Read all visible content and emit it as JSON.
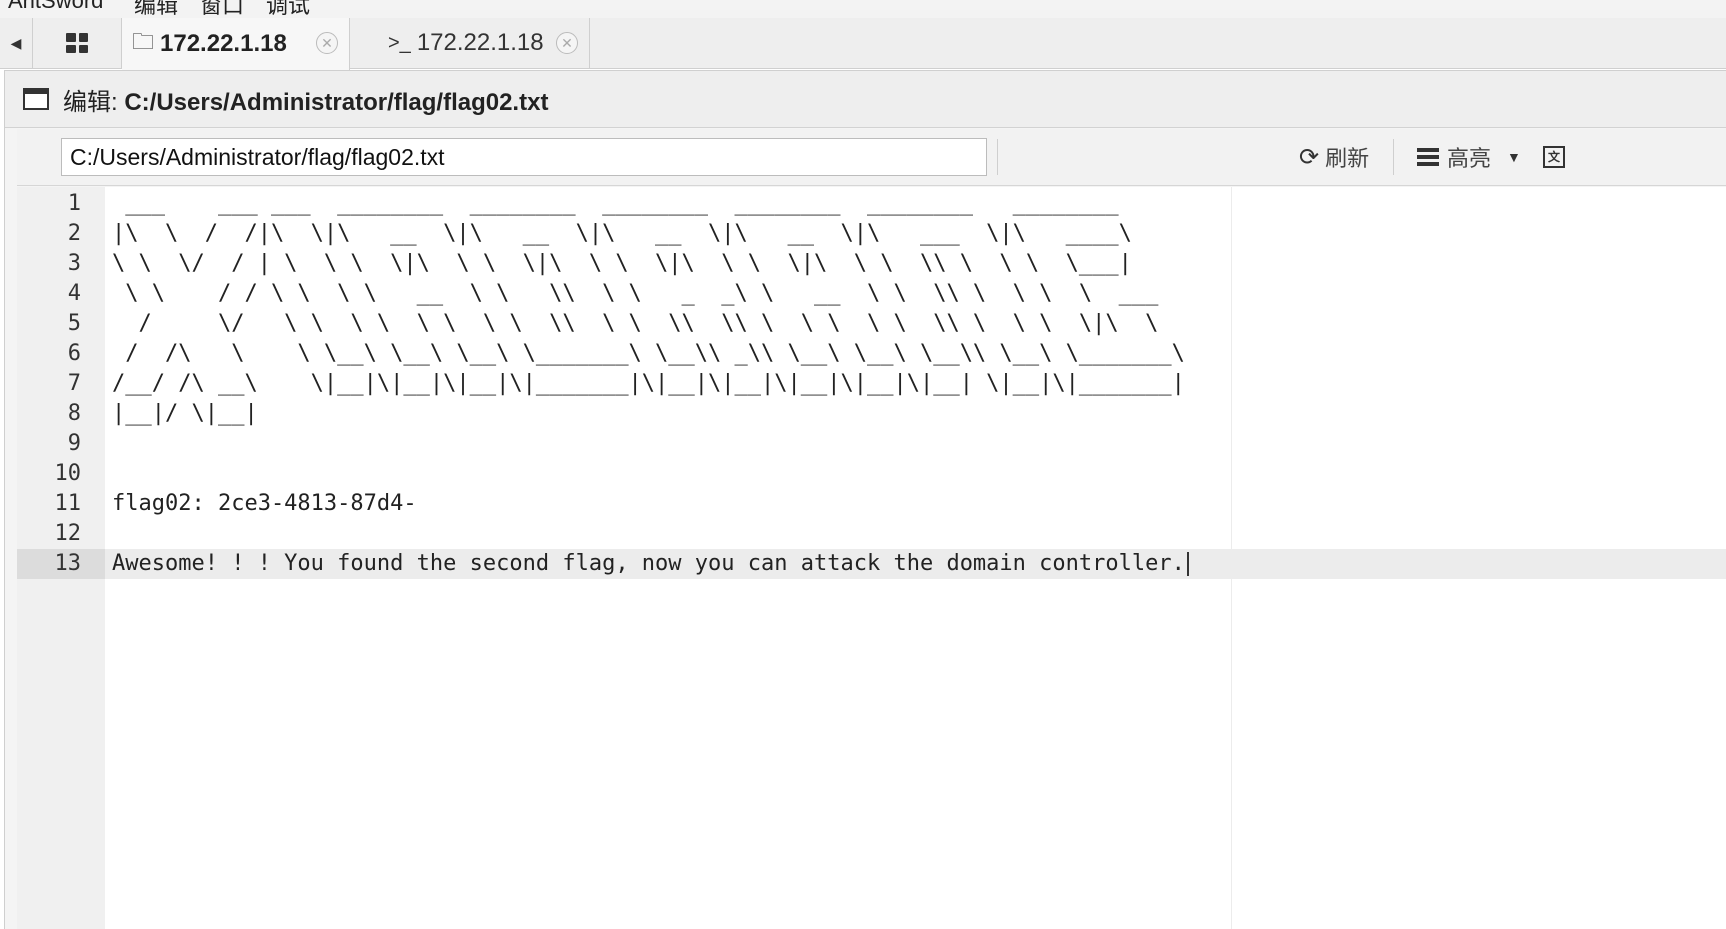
{
  "menu": [
    "AntSword",
    "编辑",
    "窗口",
    "调试"
  ],
  "tabs": [
    {
      "icon": "folder-icon",
      "label": "172.22.1.18",
      "active": true
    },
    {
      "icon": "terminal-icon",
      "label": "172.22.1.18",
      "active": false
    }
  ],
  "window": {
    "title_prefix": "编辑: ",
    "title_path": "C:/Users/Administrator/flag/flag02.txt"
  },
  "toolbar": {
    "path_value": "C:/Users/Administrator/flag/flag02.txt",
    "refresh_label": "刷新",
    "highlight_label": "高亮"
  },
  "editor": {
    "lines": [
      " ___    ___ ___  ________  ________  ________  ________  ________   ________",
      "|\\  \\  /  /|\\  \\|\\   __  \\|\\   __  \\|\\   __  \\|\\   __  \\|\\   ___  \\|\\   ____\\",
      "\\ \\  \\/  / | \\  \\ \\  \\|\\  \\ \\  \\|\\  \\ \\  \\|\\  \\ \\  \\|\\  \\ \\  \\\\ \\  \\ \\  \\___|",
      " \\ \\    / / \\ \\  \\ \\   __  \\ \\   \\\\  \\ \\   _  _\\ \\   __  \\ \\  \\\\ \\  \\ \\  \\  ___",
      "  /     \\/   \\ \\  \\ \\  \\ \\  \\ \\  \\\\  \\ \\  \\\\  \\\\ \\  \\ \\  \\ \\  \\\\ \\  \\ \\  \\|\\  \\",
      " /  /\\   \\    \\ \\__\\ \\__\\ \\__\\ \\_______\\ \\__\\\\ _\\\\ \\__\\ \\__\\ \\__\\\\ \\__\\ \\_______\\",
      "/__/ /\\ __\\    \\|__|\\|__|\\|__|\\|_______|\\|__|\\|__|\\|__|\\|__|\\|__| \\|__|\\|_______|",
      "|__|/ \\|__|",
      "",
      "",
      "flag02: 2ce3-4813-87d4-",
      "",
      "Awesome! ! ! You found the second flag, now you can attack the domain controller."
    ],
    "current_line": 13
  }
}
